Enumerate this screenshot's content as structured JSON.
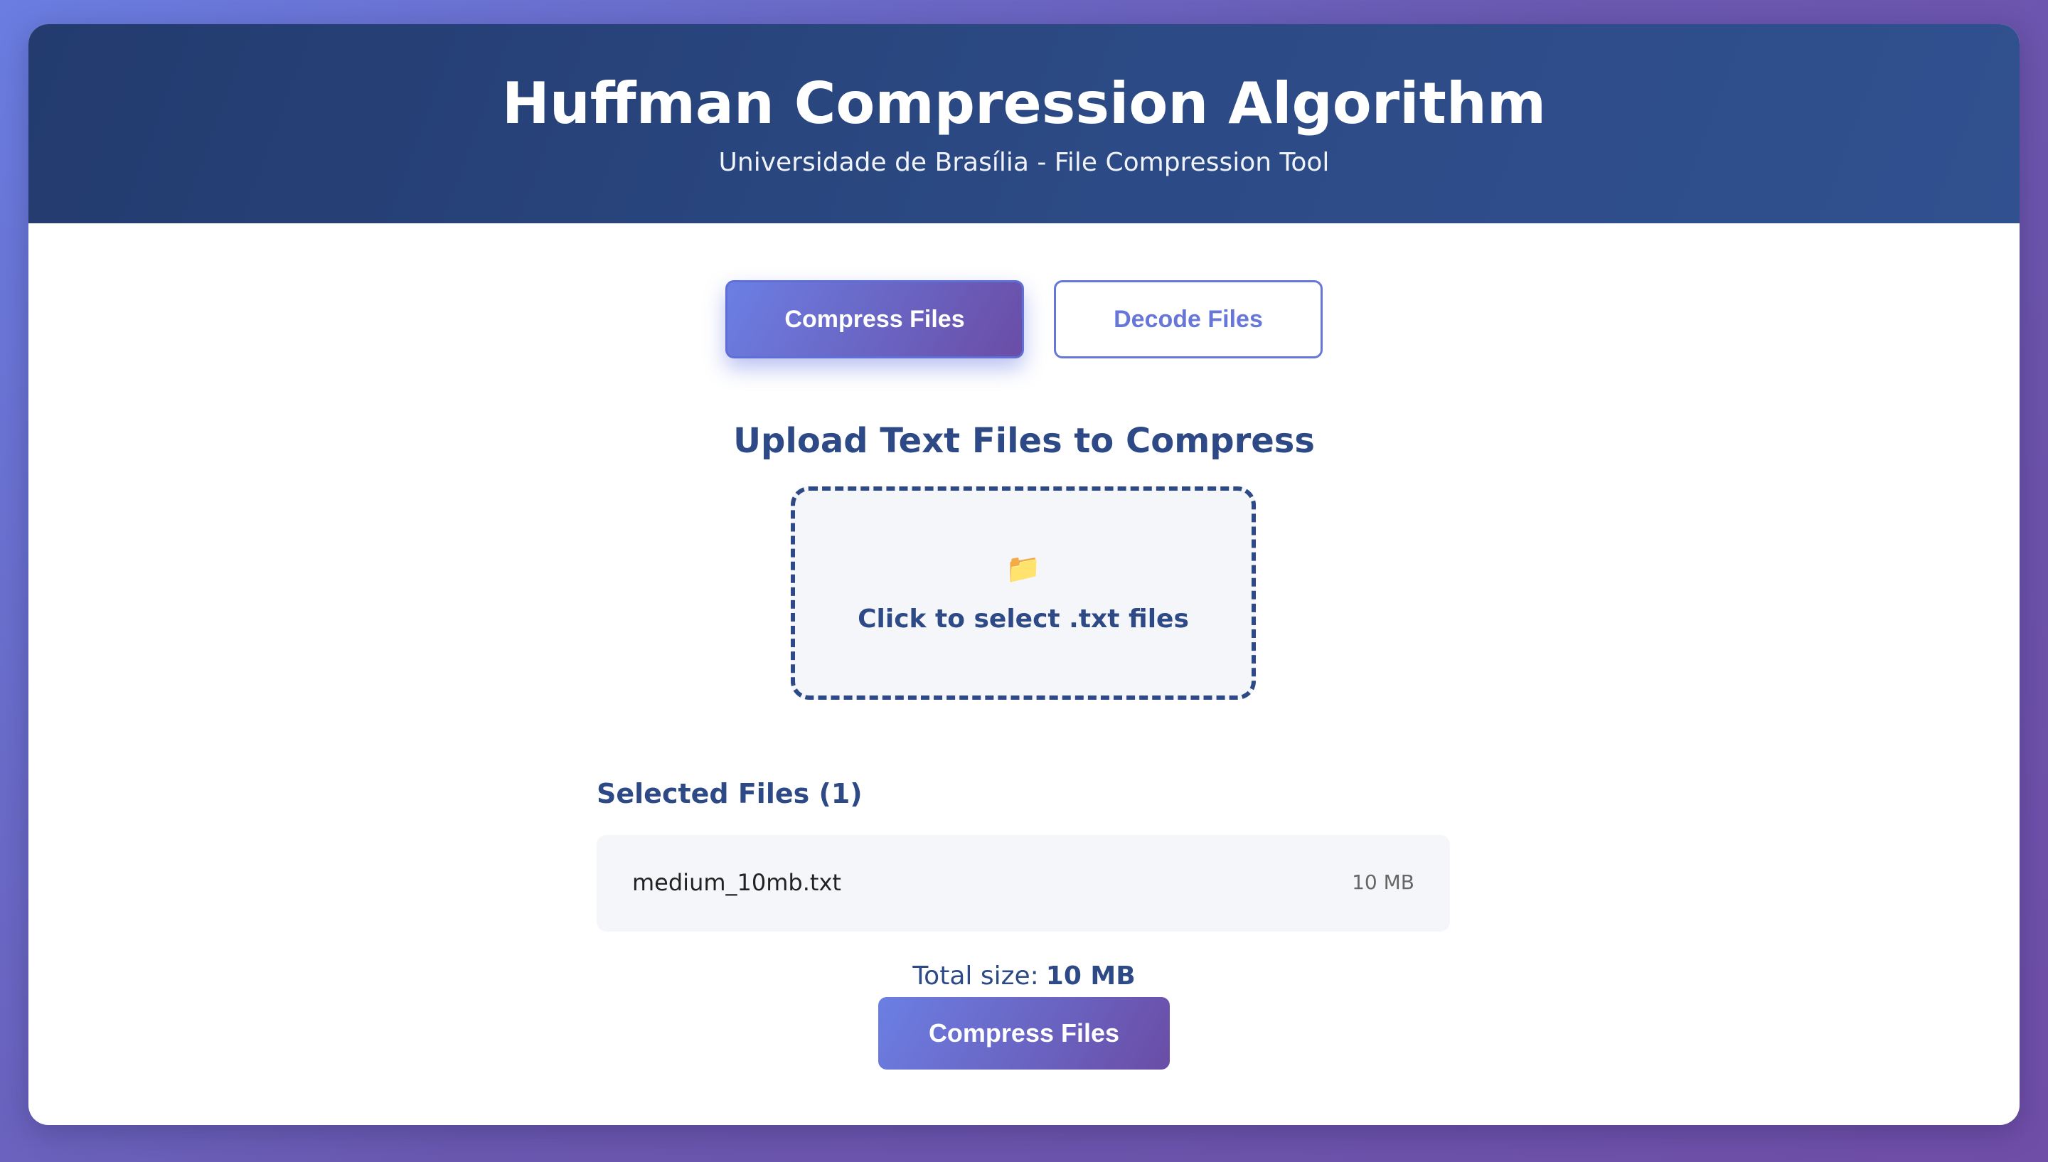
{
  "header": {
    "title": "Huffman Compression Algorithm",
    "subtitle": "Universidade de Brasília - File Compression Tool"
  },
  "tabs": [
    {
      "label": "Compress Files",
      "active": true
    },
    {
      "label": "Decode Files",
      "active": false
    }
  ],
  "upload": {
    "title": "Upload Text Files to Compress",
    "icon": "folder-icon",
    "icon_glyph": "📁",
    "prompt": "Click to select .txt files"
  },
  "files": {
    "title": "Selected Files (1)",
    "items": [
      {
        "name": "medium_10mb.txt",
        "size": "10 MB"
      }
    ]
  },
  "total": {
    "label": "Total size:",
    "value": "10 MB"
  },
  "action": {
    "compress_label": "Compress Files"
  },
  "colors": {
    "accent": "#6677d8",
    "navy": "#2e4a86",
    "header_bg": "#2a4580"
  }
}
